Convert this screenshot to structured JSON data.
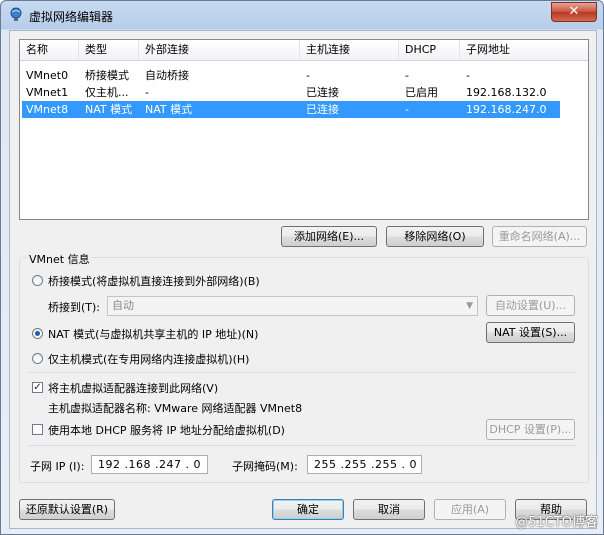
{
  "window": {
    "title": "虚拟网络编辑器",
    "close_glyph": "✕"
  },
  "table": {
    "headers": [
      "名称",
      "类型",
      "外部连接",
      "主机连接",
      "DHCP",
      "子网地址"
    ],
    "rows": [
      {
        "name": "VMnet0",
        "type": "桥接模式",
        "external": "自动桥接",
        "host": "-",
        "dhcp": "-",
        "subnet": "-"
      },
      {
        "name": "VMnet1",
        "type": "仅主机...",
        "external": "-",
        "host": "已连接",
        "dhcp": "已启用",
        "subnet": "192.168.132.0"
      },
      {
        "name": "VMnet8",
        "type": "NAT 模式",
        "external": "NAT 模式",
        "host": "已连接",
        "dhcp": "-",
        "subnet": "192.168.247.0"
      }
    ],
    "selected_row": 2
  },
  "table_buttons": {
    "add": "添加网络(E)...",
    "remove": "移除网络(O)",
    "rename": "重命名网络(A)..."
  },
  "vmnet_info": {
    "group_label": "VMnet 信息",
    "bridge_radio": "桥接模式(将虚拟机直接连接到外部网络)(B)",
    "bridge_to_label": "桥接到(T):",
    "bridge_to_value": "自动",
    "auto_settings": "自动设置(U)...",
    "nat_radio": "NAT 模式(与虚拟机共享主机的 IP 地址)(N)",
    "nat_settings": "NAT 设置(S)...",
    "hostonly_radio": "仅主机模式(在专用网络内连接虚拟机)(H)",
    "connect_adapter": "将主机虚拟适配器连接到此网络(V)",
    "adapter_name": "主机虚拟适配器名称: VMware 网络适配器 VMnet8",
    "dhcp_check": "使用本地 DHCP 服务将 IP 地址分配给虚拟机(D)",
    "dhcp_settings": "DHCP 设置(P)...",
    "subnet_ip_label": "子网 IP (I):",
    "subnet_ip_value": "192 .168 .247 . 0",
    "subnet_mask_label": "子网掩码(M):",
    "subnet_mask_value": "255 .255 .255 . 0"
  },
  "footer": {
    "restore": "还原默认设置(R)",
    "ok": "确定",
    "cancel": "取消",
    "apply": "应用(A)",
    "help": "帮助"
  },
  "watermark": "@51CTO博客",
  "colors": {
    "selection": "#3399ff",
    "title_gradient": "#c7daf1"
  }
}
